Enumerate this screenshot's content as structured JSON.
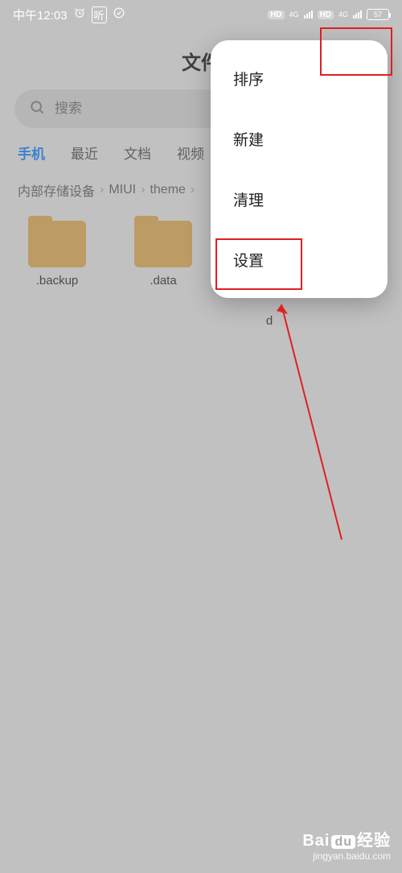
{
  "status": {
    "time": "中午12:03",
    "alarm_icon": "⏰",
    "app_icon": "听",
    "check_icon": "✓",
    "hd1": "HD",
    "net1": "4G",
    "hd2": "HD",
    "net2": "4G",
    "battery": "57"
  },
  "page": {
    "title_partial": "文件"
  },
  "search": {
    "placeholder": "搜索"
  },
  "tabs": {
    "items": [
      "手机",
      "最近",
      "文档",
      "视频"
    ],
    "active_index": 0
  },
  "breadcrumb": {
    "parts": [
      "内部存储设备",
      "MIUI",
      "theme"
    ]
  },
  "files": {
    "items": [
      {
        "name": ".backup"
      },
      {
        "name": ".data"
      },
      {
        "name": "d"
      }
    ]
  },
  "menu": {
    "items": [
      {
        "key": "sort",
        "label": "排序"
      },
      {
        "key": "new",
        "label": "新建"
      },
      {
        "key": "clean",
        "label": "清理"
      },
      {
        "key": "settings",
        "label": "设置"
      }
    ]
  },
  "watermark": {
    "brand_prefix": "Bai",
    "brand_mid": "du",
    "brand_suffix": "经验",
    "url": "jingyan.baidu.com"
  }
}
